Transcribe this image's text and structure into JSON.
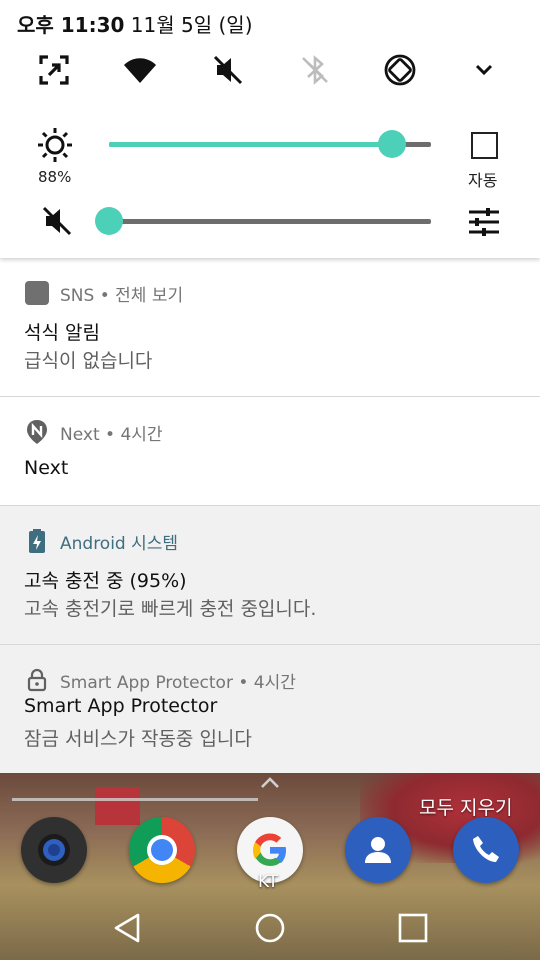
{
  "status_bar": {
    "time": "오후 11:30",
    "date": "11월 5일 (일)"
  },
  "quick_settings": {
    "tiles": [
      "screen-capture-icon",
      "wifi-icon",
      "sound-off-icon",
      "bluetooth-off-icon",
      "auto-rotate-icon",
      "expand-chevron-icon"
    ],
    "brightness": {
      "percent_label": "88%",
      "level": 0.88,
      "auto_label": "자동"
    },
    "volume": {
      "level": 0.0
    },
    "accent_color": "#4dd0b8"
  },
  "notifications": [
    {
      "app": "SNS • 전체 보기",
      "title": "석식 알림",
      "body": "급식이 없습니다",
      "icon": "sns-app-icon"
    },
    {
      "app": "Next • 4시간",
      "title": "Next",
      "body": "",
      "icon": "next-pin-icon"
    },
    {
      "app": "Android 시스템",
      "title": "고속 충전 중 (95%)",
      "body": "고속 충전기로 빠르게 충전 중입니다.",
      "icon": "battery-charging-icon"
    },
    {
      "app": "Smart App Protector • 4시간",
      "title": "Smart App Protector",
      "body": "잠금 서비스가 작동중 입니다",
      "icon": "lock-icon"
    }
  ],
  "home": {
    "clear_all": "모두 지우기",
    "dock": [
      "camera-app-icon",
      "chrome-app-icon",
      "google-app-icon",
      "contacts-app-icon",
      "phone-app-icon"
    ],
    "google_label": "KT"
  },
  "nav": [
    "back-icon",
    "home-icon",
    "recents-icon"
  ]
}
